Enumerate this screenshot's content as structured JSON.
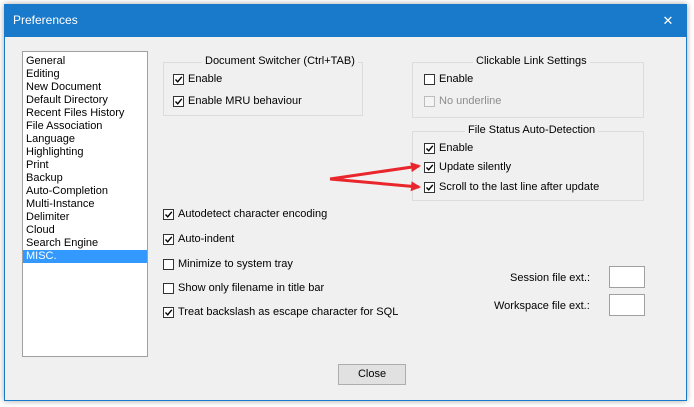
{
  "window": {
    "title": "Preferences",
    "close_glyph": "✕"
  },
  "sidebar": {
    "items": [
      {
        "label": "General"
      },
      {
        "label": "Editing"
      },
      {
        "label": "New Document"
      },
      {
        "label": "Default Directory"
      },
      {
        "label": "Recent Files History"
      },
      {
        "label": "File Association"
      },
      {
        "label": "Language"
      },
      {
        "label": "Highlighting"
      },
      {
        "label": "Print"
      },
      {
        "label": "Backup"
      },
      {
        "label": "Auto-Completion"
      },
      {
        "label": "Multi-Instance"
      },
      {
        "label": "Delimiter"
      },
      {
        "label": "Cloud"
      },
      {
        "label": "Search Engine"
      },
      {
        "label": "MISC.",
        "selected": true
      }
    ]
  },
  "document_switcher": {
    "title": "Document Switcher (Ctrl+TAB)",
    "enable": {
      "label": "Enable",
      "checked": true
    },
    "mru": {
      "label": "Enable MRU behaviour",
      "checked": true
    }
  },
  "clickable_link": {
    "title": "Clickable Link Settings",
    "enable": {
      "label": "Enable",
      "checked": false
    },
    "no_underline": {
      "label": "No underline",
      "checked": false,
      "disabled": true
    }
  },
  "file_status": {
    "title": "File Status Auto-Detection",
    "enable": {
      "label": "Enable",
      "checked": true
    },
    "update_silently": {
      "label": "Update silently",
      "checked": true
    },
    "scroll_last_line": {
      "label": "Scroll to the last line after update",
      "checked": true
    }
  },
  "options": {
    "autodetect": {
      "label": "Autodetect character encoding",
      "checked": true
    },
    "autoindent": {
      "label": "Auto-indent",
      "checked": true
    },
    "minimize_tray": {
      "label": "Minimize to system tray",
      "checked": false
    },
    "filename_title": {
      "label": "Show only filename in title bar",
      "checked": false
    },
    "backslash_sql": {
      "label": "Treat backslash as escape character for SQL",
      "checked": true
    }
  },
  "session_ext": {
    "label": "Session file ext.:",
    "value": ""
  },
  "workspace_ext": {
    "label": "Workspace file ext.:",
    "value": ""
  },
  "close_button": {
    "label": "Close"
  },
  "colors": {
    "accent": "#1979ca",
    "selection": "#3399ff",
    "annotation_arrow": "#e8262c"
  }
}
